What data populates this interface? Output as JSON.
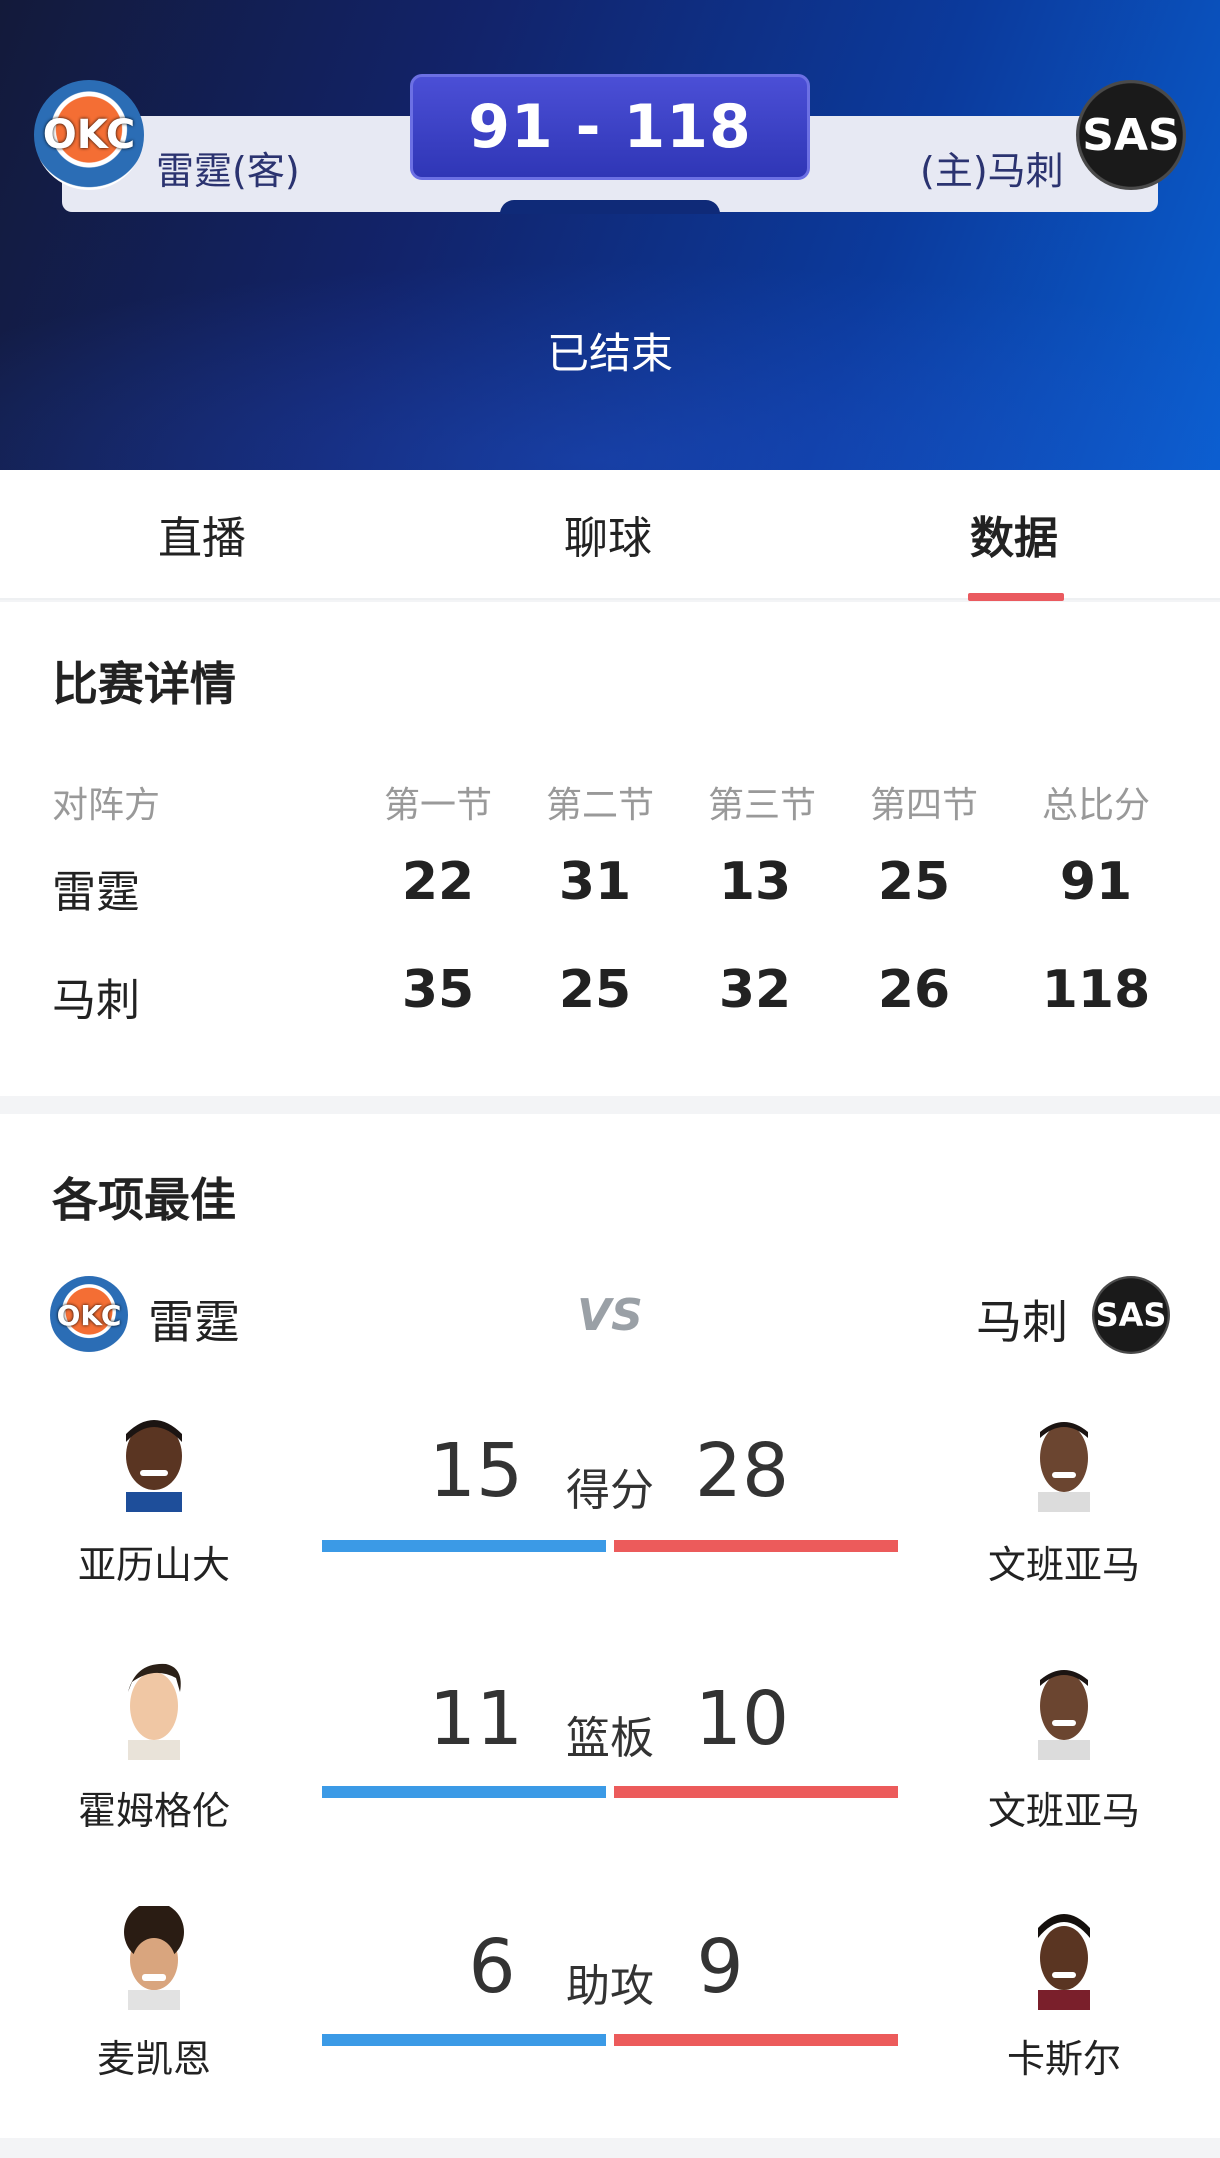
{
  "header": {
    "away_team": {
      "logo_text": "OKC",
      "label": "雷霆(客)"
    },
    "home_team": {
      "logo_text": "SAS",
      "label": "(主)马刺"
    },
    "score": "91 - 118",
    "status": "已结束"
  },
  "tabs": [
    {
      "label": "直播"
    },
    {
      "label": "聊球"
    },
    {
      "label": "数据",
      "active": true
    }
  ],
  "match_detail": {
    "title": "比赛详情",
    "columns": [
      "对阵方",
      "第一节",
      "第二节",
      "第三节",
      "第四节",
      "总比分"
    ],
    "rows": [
      {
        "team": "雷霆",
        "q1": "22",
        "q2": "31",
        "q3": "13",
        "q4": "25",
        "total": "91"
      },
      {
        "team": "马刺",
        "q1": "35",
        "q2": "25",
        "q3": "32",
        "q4": "26",
        "total": "118"
      }
    ]
  },
  "best": {
    "title": "各项最佳",
    "left_team": {
      "name": "雷霆",
      "logo_text": "OKC"
    },
    "right_team": {
      "name": "马刺",
      "logo_text": "SAS"
    },
    "vs": "VS",
    "stats": [
      {
        "label": "得分",
        "left_player": "亚历山大",
        "left_value": "15",
        "right_player": "文班亚马",
        "right_value": "28"
      },
      {
        "label": "篮板",
        "left_player": "霍姆格伦",
        "left_value": "11",
        "right_player": "文班亚马",
        "right_value": "10"
      },
      {
        "label": "助攻",
        "left_player": "麦凯恩",
        "left_value": "6",
        "right_player": "卡斯尔",
        "right_value": "9"
      }
    ]
  },
  "colors": {
    "tab_underline": "#ea5a5f",
    "left_bar": "#3b9ae6",
    "right_bar": "#ec5b5b",
    "score_box": "#2f36b6"
  }
}
